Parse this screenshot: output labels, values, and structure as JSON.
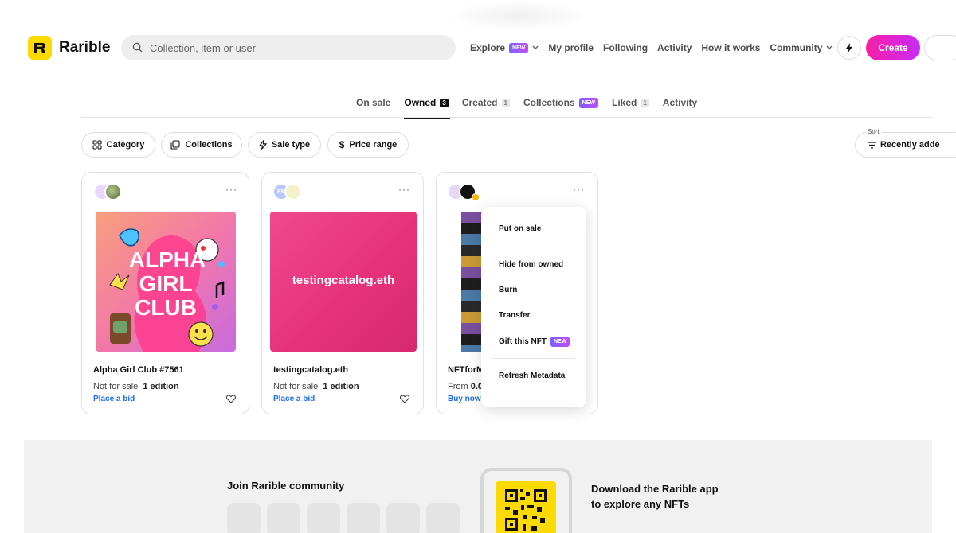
{
  "header": {
    "brand": "Rarible",
    "search_placeholder": "Collection, item or user",
    "nav": {
      "explore": "Explore",
      "explore_badge": "NEW",
      "my_profile": "My profile",
      "following": "Following",
      "activity": "Activity",
      "how_it_works": "How it works",
      "community": "Community"
    },
    "create_label": "Create"
  },
  "tabs": [
    {
      "label": "On sale"
    },
    {
      "label": "Owned",
      "count": "3"
    },
    {
      "label": "Created",
      "count": "1"
    },
    {
      "label": "Collections",
      "badge": "NEW"
    },
    {
      "label": "Liked",
      "count": "1"
    },
    {
      "label": "Activity"
    }
  ],
  "filters": {
    "category": "Category",
    "collections": "Collections",
    "sale_type": "Sale type",
    "price_range": "Price range",
    "sort_label": "Sort",
    "sort_value": "Recently adde"
  },
  "cards": [
    {
      "title": "Alpha Girl Club #7561",
      "status": "Not for sale",
      "editions": "1 edition",
      "action": "Place a bid",
      "art_text_1": "ALPHA",
      "art_text_2": "GIRL",
      "art_text_3": "CLUB"
    },
    {
      "title": "testingcatalog.eth",
      "status": "Not for sale",
      "editions": "1 edition",
      "action": "Place a bid",
      "art_text": "testingcatalog.eth",
      "avatar_text": "EN"
    },
    {
      "title": "NFTforM",
      "price_prefix": "From",
      "price": "0.0",
      "action": "Buy now"
    }
  ],
  "menu": {
    "put_on_sale": "Put on sale",
    "hide_from_owned": "Hide from owned",
    "burn": "Burn",
    "transfer": "Transfer",
    "gift": "Gift this NFT",
    "gift_badge": "NEW",
    "refresh": "Refresh Metadata"
  },
  "footer": {
    "join_title": "Join Rarible community",
    "app_line_1": "Download the Rarible app",
    "app_line_2": "to explore any NFTs"
  },
  "colors": {
    "brand_yellow": "#FEDA03",
    "create_gradient_start": "#f61fa7",
    "create_gradient_end": "#c72bf5",
    "link_blue": "#1e6fe8"
  }
}
